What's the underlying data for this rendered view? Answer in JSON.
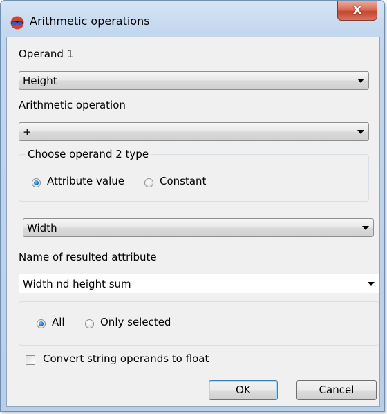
{
  "window": {
    "title": "Arithmetic operations",
    "close_label": "X",
    "icon": "3d-glasses-icon"
  },
  "operand1": {
    "label": "Operand 1",
    "value": "Height"
  },
  "operation": {
    "label": "Arithmetic operation",
    "value": "+"
  },
  "operand2_type": {
    "title": "Choose operand 2 type",
    "options": [
      {
        "label": "Attribute value",
        "selected": true
      },
      {
        "label": "Constant",
        "selected": false
      }
    ]
  },
  "operand2": {
    "value": "Width"
  },
  "result_attribute": {
    "label": "Name of resulted attribute",
    "value": "Width nd height sum"
  },
  "scope": {
    "options": [
      {
        "label": "All",
        "selected": true
      },
      {
        "label": "Only selected",
        "selected": false
      }
    ]
  },
  "convert_checkbox": {
    "label": "Convert string operands to float",
    "checked": false
  },
  "buttons": {
    "ok": "OK",
    "cancel": "Cancel"
  }
}
